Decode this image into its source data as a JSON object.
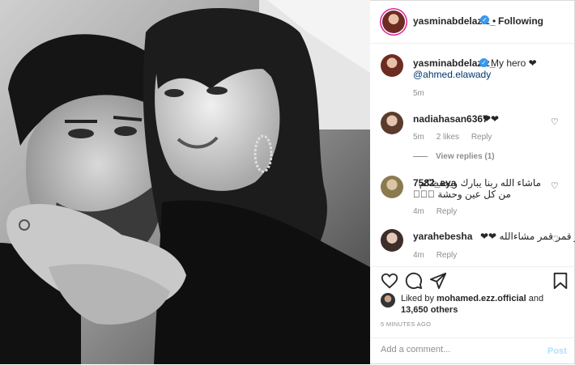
{
  "header": {
    "username": "yasminabdelaziz_",
    "separator": "•",
    "follow_status": "Following"
  },
  "caption": {
    "username": "yasminabdelaziz_",
    "text": "My hero ❤",
    "mention": "@ahmed.elawady",
    "time": "5m"
  },
  "comments": [
    {
      "username": "nadiahasan6367",
      "text": "❤❤",
      "time": "5m",
      "likes": "2 likes",
      "reply": "Reply",
      "view_replies": "View replies (1)"
    },
    {
      "username": "7582_aya",
      "text_line1": "ماشاء الله ربنا يبارك ويحفظكم",
      "text_line2": "من كل عين وحشة 🏻🏻🏻",
      "time": "4m",
      "reply": "Reply"
    },
    {
      "username": "yarahebesha",
      "text": "قمر قمر قمر مشاءالله ❤❤",
      "time": "4m",
      "reply": "Reply"
    }
  ],
  "likes": {
    "prefix": "Liked by",
    "user": "mohamed.ezz.official",
    "suffix": "and",
    "others": "13,650 others"
  },
  "timestamp": "5 MINUTES AGO",
  "add_comment": {
    "placeholder": "Add a comment...",
    "post_label": "Post"
  },
  "icons": {
    "verified": "verified-badge-icon",
    "like": "heart-icon",
    "comment": "comment-icon",
    "share": "share-icon",
    "save": "bookmark-icon"
  }
}
